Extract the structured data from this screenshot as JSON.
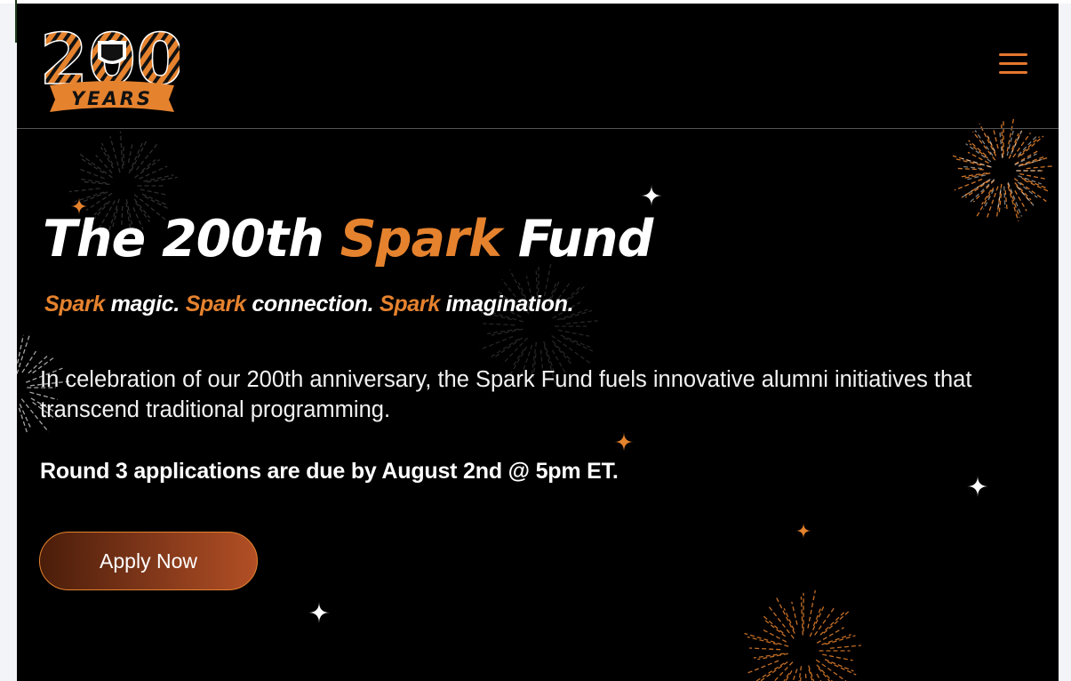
{
  "header": {
    "logo": {
      "number": "200",
      "ribbon_text": "YEARS"
    },
    "menu_icon": "hamburger-menu-icon"
  },
  "hero": {
    "title": {
      "part1": "The 200th ",
      "highlight": "Spark",
      "part2": " Fund"
    },
    "tagline": {
      "spark1": "Spark",
      "text1": " magic. ",
      "spark2": "Spark",
      "text2": " connection. ",
      "spark3": "Spark",
      "text3": " imagination."
    },
    "description": "In celebration of our 200th anniversary, the Spark Fund fuels innovative alumni initiatives that transcend traditional programming.",
    "deadline": "Round 3 applications are due by August 2nd @ 5pm ET.",
    "apply_button": "Apply Now"
  },
  "colors": {
    "accent": "#e5822e",
    "background": "#000000",
    "text": "#ffffff"
  },
  "decorations": [
    "firework-icon",
    "sparkle-star-icon"
  ]
}
